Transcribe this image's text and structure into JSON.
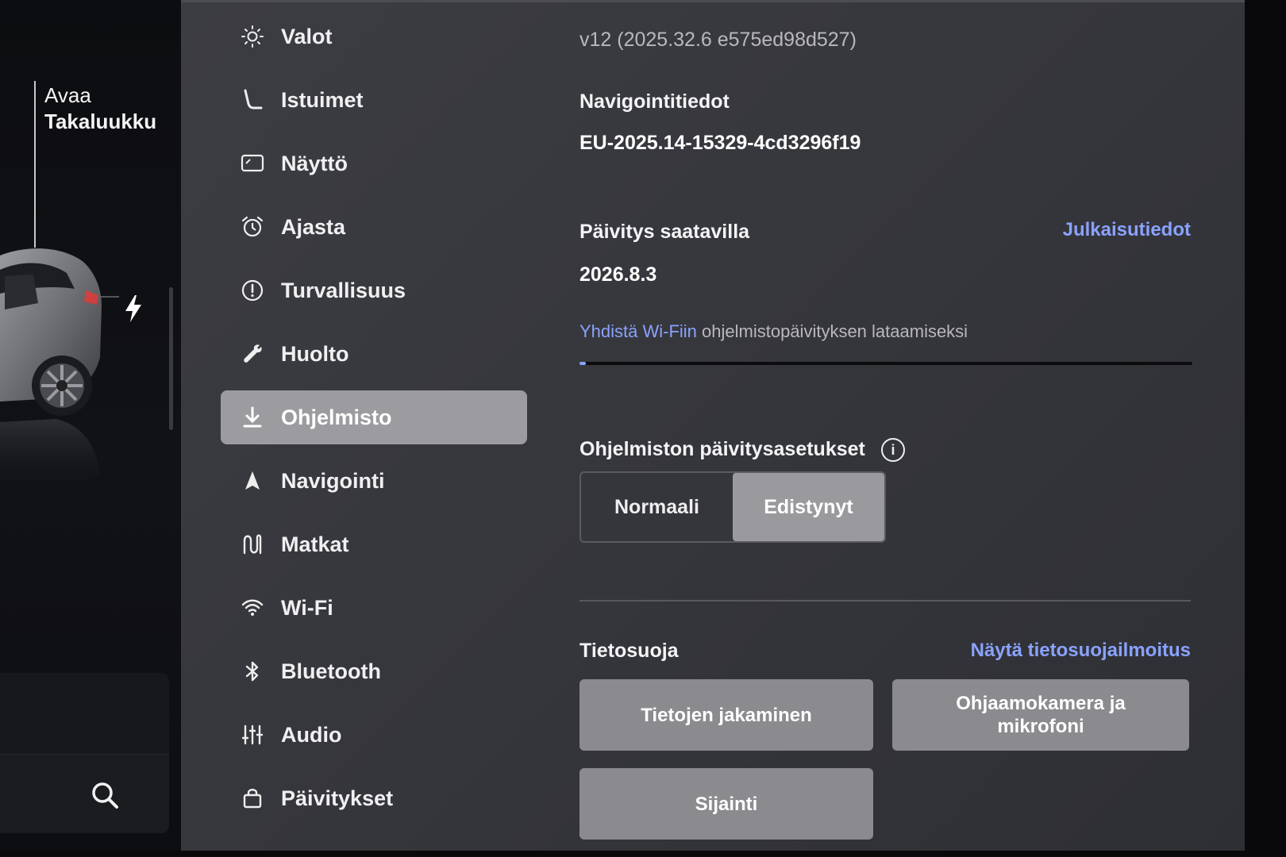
{
  "car_panel": {
    "trunk_action": "Avaa",
    "trunk_name": "Takaluukku"
  },
  "nav": {
    "items": [
      {
        "label": "Valot",
        "icon": "light-icon"
      },
      {
        "label": "Istuimet",
        "icon": "seat-icon"
      },
      {
        "label": "Näyttö",
        "icon": "display-icon"
      },
      {
        "label": "Ajasta",
        "icon": "alarm-clock-icon"
      },
      {
        "label": "Turvallisuus",
        "icon": "warning-circle-icon"
      },
      {
        "label": "Huolto",
        "icon": "wrench-icon"
      },
      {
        "label": "Ohjelmisto",
        "icon": "download-icon",
        "active": true
      },
      {
        "label": "Navigointi",
        "icon": "navigation-arrow-icon"
      },
      {
        "label": "Matkat",
        "icon": "trips-icon"
      },
      {
        "label": "Wi-Fi",
        "icon": "wifi-icon"
      },
      {
        "label": "Bluetooth",
        "icon": "bluetooth-icon"
      },
      {
        "label": "Audio",
        "icon": "equalizer-icon"
      },
      {
        "label": "Päivitykset",
        "icon": "shopping-bag-icon"
      }
    ]
  },
  "software": {
    "version": "v12 (2025.32.6 e575ed98d527)",
    "nav_data_heading": "Navigointitiedot",
    "nav_data_value": "EU-2025.14-15329-4cd3296f19",
    "update_heading": "Päivitys saatavilla",
    "update_version": "2026.8.3",
    "release_notes_link": "Julkaisutiedot",
    "wifi_link": "Yhdistä Wi-Fiin",
    "wifi_hint": "ohjelmistopäivityksen lataamiseksi",
    "download_progress_fraction": 0.01,
    "update_settings_heading": "Ohjelmiston päivitysasetukset",
    "update_mode_options": [
      "Normaali",
      "Edistynyt"
    ],
    "update_mode_selected": "Edistynyt"
  },
  "privacy": {
    "heading": "Tietosuoja",
    "notice_link": "Näytä tietosuojailmoitus",
    "buttons": {
      "data_sharing": "Tietojen jakaminen",
      "cabin_camera_line1": "Ohjaamokamera ja",
      "cabin_camera_line2": "mikrofoni",
      "location": "Sijainti"
    }
  },
  "colors": {
    "accent_link": "#8aa2ff",
    "active_nav_bg": "#9c9ca0",
    "panel_bg": "#3a3b40"
  }
}
